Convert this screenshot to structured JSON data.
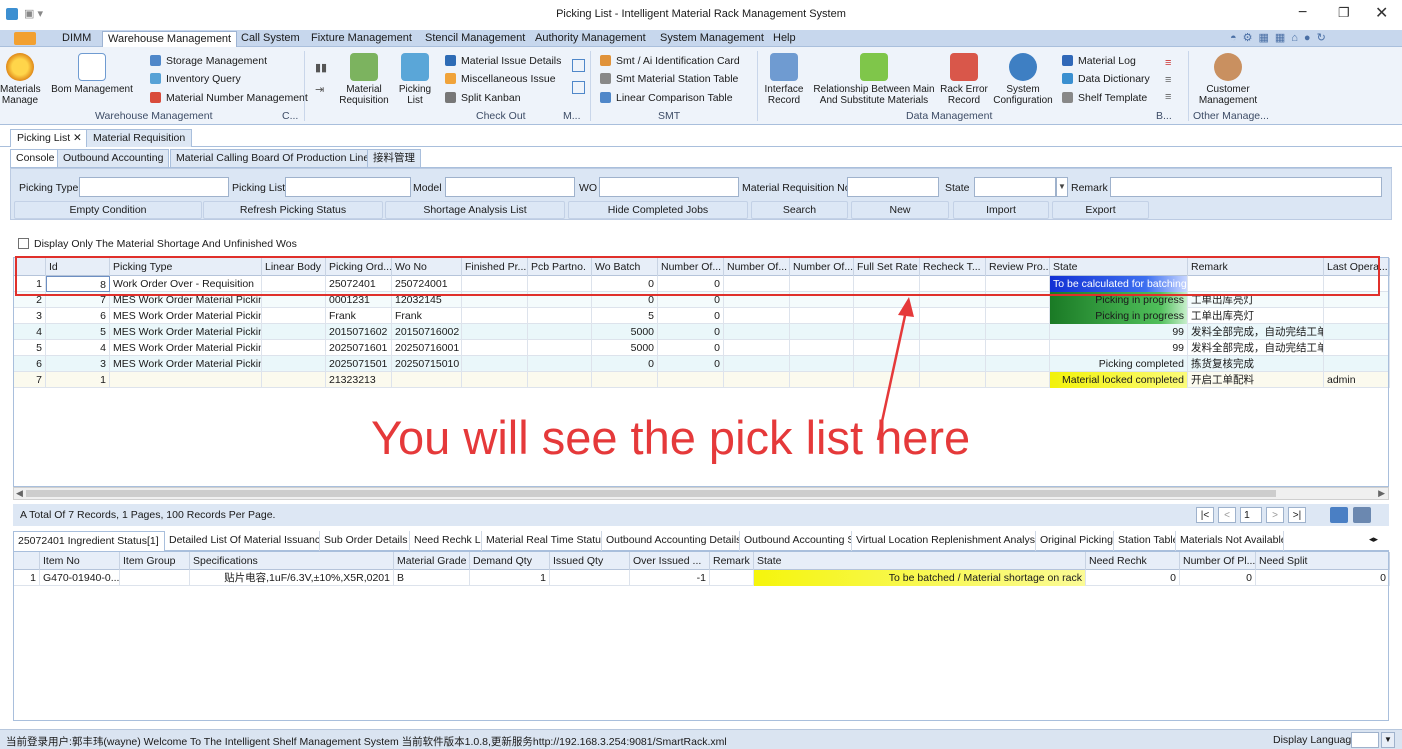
{
  "window": {
    "title": "Picking List - Intelligent Material Rack Management System",
    "controls": [
      "minimize",
      "maximize",
      "close"
    ]
  },
  "menubar": {
    "items": [
      "DIMM",
      "Warehouse Management",
      "Call System",
      "Fixture Management",
      "Stencil Management",
      "Authority Management",
      "System Management",
      "Help"
    ],
    "active": "Warehouse Management"
  },
  "ribbon": {
    "materials_manage": "Materials\nManage",
    "bom_management": "Bom Management",
    "storage_management": "Storage Management",
    "inventory_query": "Inventory Query",
    "material_number_management": "Material Number Management",
    "warehouse_group": "Warehouse Management",
    "c_group": "C...",
    "material_requisition": "Material\nRequisition",
    "picking_list": "Picking\nList",
    "material_issue_details": "Material Issue Details",
    "miscellaneous_issue": "Miscellaneous Issue",
    "split_kanban": "Split Kanban",
    "checkout_group": "Check Out",
    "m_group": "M...",
    "smt_ai_card": "Smt / Ai Identification Card",
    "smt_station_table": "Smt Material Station Table",
    "linear_comparison": "Linear Comparison Table",
    "smt_group": "SMT",
    "interface_record": "Interface\nRecord",
    "relationship": "Relationship Between Main\nAnd Substitute Materials",
    "rack_error_record": "Rack Error\nRecord",
    "system_configuration": "System\nConfiguration",
    "material_log": "Material Log",
    "data_dictionary": "Data Dictionary",
    "shelf_template": "Shelf Template",
    "data_group": "Data Management",
    "b_group": "B...",
    "customer_management": "Customer\nManagement",
    "other_group": "Other Manage..."
  },
  "doc_tabs": [
    "Picking List",
    "Material Requisition"
  ],
  "sub_tabs": [
    "Console",
    "Outbound Accounting",
    "Material Calling Board Of Production Line",
    "接料管理"
  ],
  "filters": {
    "picking_type": "Picking Type",
    "picking_list": "Picking List",
    "model": "Model",
    "wo": "WO",
    "material_requisition_no": "Material Requisition No",
    "state": "State",
    "remark": "Remark"
  },
  "buttons": [
    "Empty Condition",
    "Refresh Picking Status",
    "Shortage Analysis List",
    "Hide Completed Jobs",
    "Search",
    "New",
    "Import",
    "Export"
  ],
  "checkbox_label": "Display Only The Material Shortage And Unfinished Wos",
  "grid1": {
    "headers": [
      "Id",
      "Picking Type",
      "Linear Body",
      "Picking Ord...",
      "Wo No",
      "Finished Pr...",
      "Pcb Partno.",
      "Wo Batch",
      "Number Of...",
      "Number Of...",
      "Number Of...",
      "Full Set Rate",
      "Recheck T...",
      "Review Pro...",
      "State",
      "Remark",
      "Last Opera..."
    ],
    "rows": [
      {
        "n": "1",
        "id": "8",
        "type": "Work Order Over - Requisition",
        "order": "25072401",
        "wo": "250724001",
        "batch": "0",
        "num": "0",
        "state": "To be calculated for batching",
        "remark": "",
        "last": "",
        "stateColor": "#1e3ed8"
      },
      {
        "n": "2",
        "id": "7",
        "type": "MES Work Order Material Picking",
        "order": "0001231",
        "wo": "12032145",
        "batch": "0",
        "num": "0",
        "state": "Picking in progress",
        "remark": "工单出库亮灯",
        "last": "",
        "stateColor": "#1f8a2c"
      },
      {
        "n": "3",
        "id": "6",
        "type": "MES Work Order Material Picking",
        "order": "Frank",
        "wo": "Frank",
        "batch": "5",
        "num": "0",
        "state": "Picking in progress",
        "remark": "工单出库亮灯",
        "last": "",
        "stateColor": "#1f8a2c"
      },
      {
        "n": "4",
        "id": "5",
        "type": "MES Work Order Material Picking",
        "order": "2015071602",
        "wo": "20150716002",
        "batch": "5000",
        "num": "0",
        "state": "99",
        "remark": "发料全部完成，自动完结工单",
        "last": "",
        "stateColor": ""
      },
      {
        "n": "5",
        "id": "4",
        "type": "MES Work Order Material Picking",
        "order": "2025071601",
        "wo": "20250716001",
        "batch": "5000",
        "num": "0",
        "state": "99",
        "remark": "发料全部完成，自动完结工单",
        "last": "",
        "stateColor": ""
      },
      {
        "n": "6",
        "id": "3",
        "type": "MES Work Order Material Picking",
        "order": "2025071501",
        "wo": "20250715010",
        "batch": "0",
        "num": "0",
        "state": "Picking completed",
        "remark": "拣货复核完成",
        "last": "",
        "stateColor": ""
      },
      {
        "n": "7",
        "id": "1",
        "type": "",
        "order": "21323213",
        "wo": "",
        "batch": "",
        "num": "",
        "state": "Material locked completed",
        "remark": "开启工单配料",
        "last": "admin",
        "stateColor": "#f3f316"
      }
    ]
  },
  "annotation": "You will see the pick list here",
  "pager": {
    "summary": "A Total Of 7 Records, 1 Pages, 100 Records Per Page.",
    "page": "1"
  },
  "bottom_tabs": [
    "25072401 Ingredient Status[1]",
    "Detailed List Of Material Issuance",
    "Sub Order Details",
    "Need Rechk List",
    "Material Real Time Status",
    "Outbound Accounting Details",
    "Outbound Accounting Summary",
    "Virtual Location Replenishment Analysis",
    "Original Picking List",
    "Station Table",
    "Materials Not Available F"
  ],
  "grid2": {
    "headers": [
      "Item No",
      "Item Group",
      "Specifications",
      "Material Grade",
      "Demand Qty",
      "Issued Qty",
      "Over Issued ...",
      "Remark",
      "State",
      "Need Rechk",
      "Number Of Pl...",
      "Need Split"
    ],
    "rows": [
      {
        "n": "1",
        "item": "G470-01940-0...",
        "group": "",
        "spec": "贴片电容,1uF/6.3V,±10%,X5R,0201",
        "grade": "B",
        "demand": "1",
        "issued": "",
        "over": "-1",
        "remark": "",
        "state": "To be batched / Material shortage on rack",
        "rechk": "0",
        "num": "0",
        "split": "0"
      }
    ]
  },
  "statusbar": {
    "left": "当前登录用户:郭丰玮(wayne)  Welcome To The Intelligent Shelf Management System  当前软件版本1.0.8,更新服务http://192.168.3.254:9081/SmartRack.xml",
    "right": "Display Language"
  },
  "colors": {
    "accent": "#3b6fb6",
    "annotation": "#e5393a",
    "progress_green": "#1f8a2c",
    "batching_blue": "#1e3ed8",
    "lock_yellow": "#f3f316"
  }
}
